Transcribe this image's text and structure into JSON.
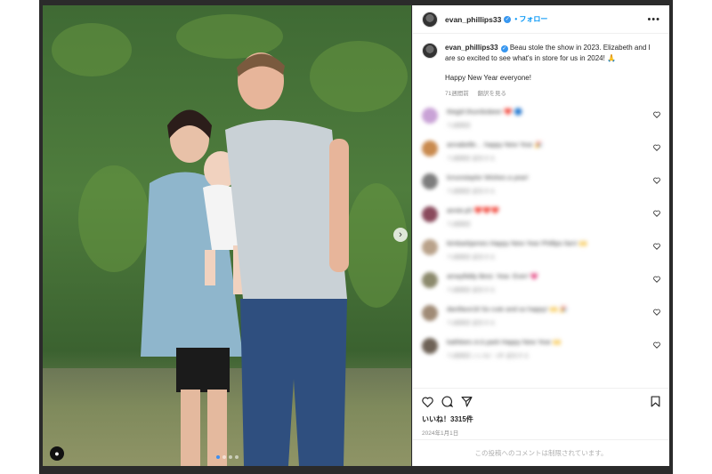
{
  "post": {
    "username": "evan_phillips33",
    "follow_label": "フォロー",
    "more_label": "•••",
    "caption_line1": "Beau stole the show in 2023. Elizabeth and I are so excited to see what's in store for us in 2024! 🙏",
    "caption_line2": "Happy New Year everyone!",
    "time_ago": "71週間前",
    "translate_label": "翻訳を見る",
    "likes": "いいね！3315件",
    "date": "2024年1月1日",
    "comments_disabled": "この投稿へのコメントは制限されています。"
  },
  "comments": [
    {
      "text": "thegirl.thumbsbeer ❤️ 🔵",
      "meta": "71週間前",
      "avatar_color": "#c9a2d6"
    },
    {
      "text": "annabelle… happy New Year 🎉",
      "meta": "71週間前   返信する",
      "avatar_color": "#c98a4e"
    },
    {
      "text": "lcnunstaylor Wishes a year!",
      "meta": "71週間前   返信する",
      "avatar_color": "#7d7d7d"
    },
    {
      "text": "annie.ph ❤️❤️❤️",
      "meta": "71週間前",
      "avatar_color": "#8a4a5c"
    },
    {
      "text": "kimbarkjames Happy New Year Phillips fam! 🙌",
      "meta": "71週間前   返信する",
      "avatar_color": "#b9a28a"
    },
    {
      "text": "amayfiddy Best. Year. Ever! 💗",
      "meta": "71週間前   返信する",
      "avatar_color": "#8c8a6d"
    },
    {
      "text": "daniface18 So cute and so happy! 🙌 🎉",
      "meta": "71週間前   返信する",
      "avatar_color": "#a08b76"
    },
    {
      "text": "kathleen.m.k.park Happy New Year 🙌",
      "meta": "71週間前   いいね！1件   返信する",
      "avatar_color": "#6e6256"
    }
  ],
  "colors": {
    "accent": "#0095f6",
    "verified": "#3897f0",
    "carousel_active_dot": "#3d8ef0"
  },
  "icons": {
    "verified": "verified-badge-icon",
    "next": "chevron-right-icon",
    "tag": "person-tag-icon",
    "like": "heart-icon",
    "comment": "speech-bubble-icon",
    "share": "paper-plane-icon",
    "save": "bookmark-icon"
  }
}
